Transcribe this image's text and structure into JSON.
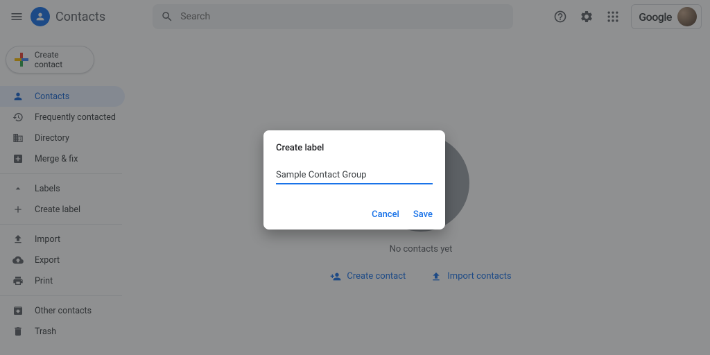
{
  "header": {
    "appTitle": "Contacts",
    "searchPlaceholder": "Search",
    "brand": "Google"
  },
  "sidebar": {
    "create": "Create contact",
    "items": {
      "contacts": "Contacts",
      "frequent": "Frequently contacted",
      "directory": "Directory",
      "merge": "Merge & fix",
      "labels": "Labels",
      "createLabel": "Create label",
      "import": "Import",
      "export": "Export",
      "print": "Print",
      "other": "Other contacts",
      "trash": "Trash"
    }
  },
  "main": {
    "emptyText": "No contacts yet",
    "createContact": "Create contact",
    "importContacts": "Import contacts"
  },
  "dialog": {
    "title": "Create label",
    "value": "Sample Contact Group",
    "cancel": "Cancel",
    "save": "Save"
  }
}
